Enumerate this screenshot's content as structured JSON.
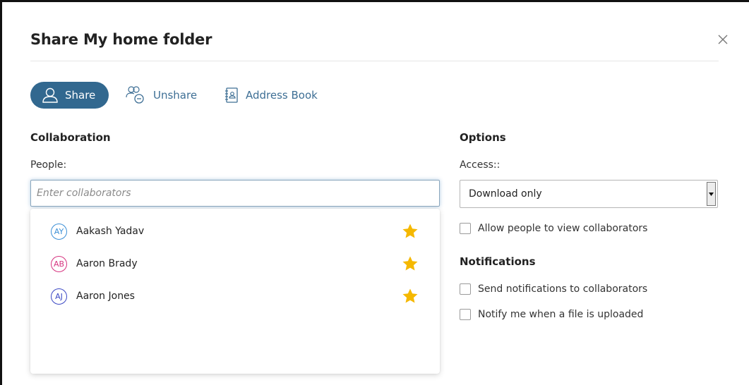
{
  "dialog": {
    "title": "Share My home folder"
  },
  "tabs": [
    {
      "label": "Share",
      "icon": "user-icon",
      "active": true
    },
    {
      "label": "Unshare",
      "icon": "users-remove-icon",
      "active": false
    },
    {
      "label": "Address Book",
      "icon": "address-book-icon",
      "active": false
    }
  ],
  "collaboration": {
    "heading": "Collaboration",
    "people_label": "People:",
    "input_placeholder": "Enter collaborators",
    "input_value": "",
    "suggestions": [
      {
        "initials": "AY",
        "name": "Aakash Yadav",
        "color": "#3b8fd6",
        "favorite": true
      },
      {
        "initials": "AB",
        "name": "Aaron Brady",
        "color": "#d6337f",
        "favorite": true
      },
      {
        "initials": "AJ",
        "name": "Aaron Jones",
        "color": "#3b48c4",
        "favorite": true
      }
    ]
  },
  "options": {
    "heading": "Options",
    "access_label": "Access::",
    "access_value": "Download only",
    "allow_view_label": "Allow people to view collaborators"
  },
  "notifications": {
    "heading": "Notifications",
    "send_label": "Send notifications to collaborators",
    "notify_upload_label": "Notify me when a file is uploaded"
  },
  "colors": {
    "accent": "#32688f",
    "link": "#3e6f95",
    "star": "#f5b800"
  }
}
